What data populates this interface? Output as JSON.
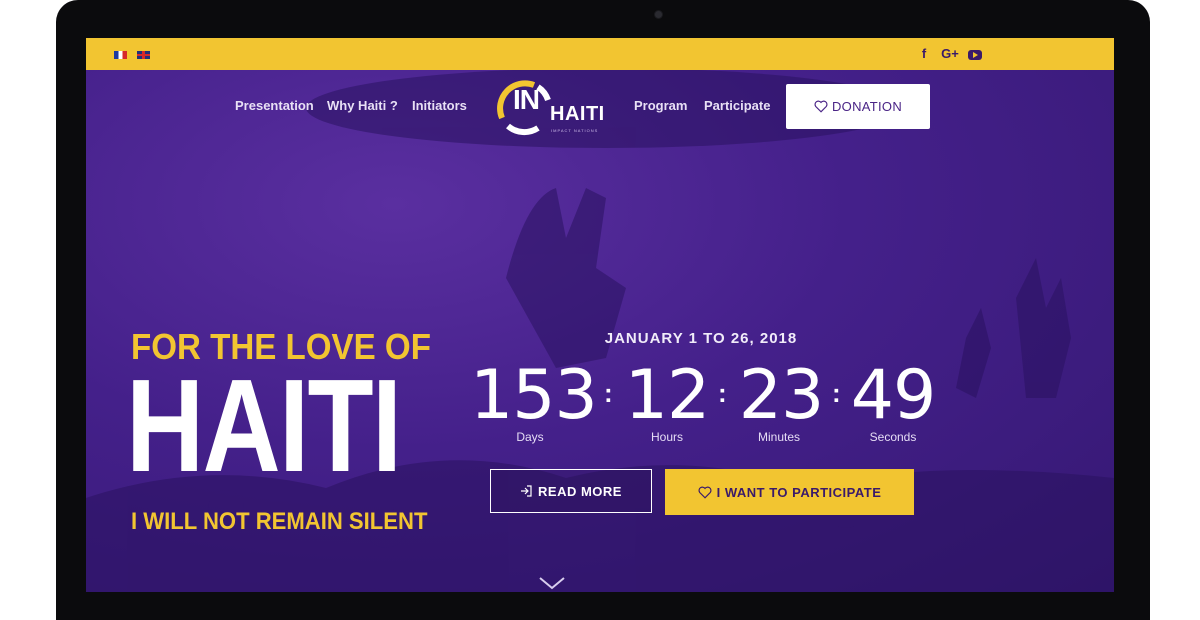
{
  "languages": [
    {
      "icon": "french-flag-icon"
    },
    {
      "icon": "uk-flag-icon"
    }
  ],
  "social": {
    "facebook_glyph": "f",
    "googleplus_glyph": "G+",
    "youtube_icon": "youtube-icon"
  },
  "nav": {
    "left": [
      "Presentation",
      "Why Haiti ?",
      "Initiators"
    ],
    "right": [
      "Program",
      "Participate"
    ],
    "donation_label": "DONATION"
  },
  "logo": {
    "in_text": "IN",
    "haiti_text": "HAITI",
    "tagline": "IMPACT NATIONS"
  },
  "hero": {
    "line1": "FOR THE LOVE OF",
    "line2": "HAITI",
    "line3": "I WILL NOT REMAIN SILENT"
  },
  "event": {
    "dates": "JANUARY 1 TO 26, 2018"
  },
  "countdown": {
    "separator": ":",
    "units": [
      {
        "value": "153",
        "label": "Days"
      },
      {
        "value": "12",
        "label": "Hours"
      },
      {
        "value": "23",
        "label": "Minutes"
      },
      {
        "value": "49",
        "label": "Seconds"
      }
    ]
  },
  "buttons": {
    "read_more": "READ MORE",
    "participate": "I WANT TO PARTICIPATE"
  },
  "colors": {
    "accent_yellow": "#f2c531",
    "brand_purple": "#44208a",
    "bezel": "#0b0b0d"
  }
}
